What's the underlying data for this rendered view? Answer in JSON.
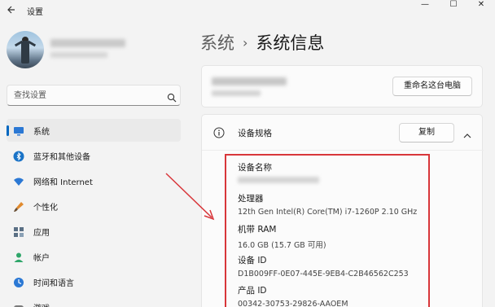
{
  "window": {
    "title": "设置",
    "back_icon": "back-arrow-icon",
    "controls": [
      "—",
      "☐",
      "✕"
    ]
  },
  "search": {
    "placeholder": "查找设置"
  },
  "sidebar": {
    "items": [
      {
        "label": "系统",
        "icon": "monitor-icon",
        "selected": true
      },
      {
        "label": "蓝牙和其他设备",
        "icon": "bluetooth-icon"
      },
      {
        "label": "网络和 Internet",
        "icon": "wifi-icon"
      },
      {
        "label": "个性化",
        "icon": "brush-icon"
      },
      {
        "label": "应用",
        "icon": "apps-icon"
      },
      {
        "label": "帐户",
        "icon": "person-icon"
      },
      {
        "label": "时间和语言",
        "icon": "clock-globe-icon"
      },
      {
        "label": "游戏",
        "icon": "gamepad-icon"
      }
    ]
  },
  "breadcrumb": {
    "parent": "系统",
    "separator": "›",
    "current": "系统信息"
  },
  "device_card": {
    "rename_label": "重命名这台电脑"
  },
  "specs": {
    "title": "设备规格",
    "copy_label": "复制",
    "rows": [
      {
        "label": "设备名称",
        "value": ""
      },
      {
        "label": "处理器",
        "value": "12th Gen Intel(R) Core(TM) i7-1260P   2.10 GHz"
      },
      {
        "label": "机带 RAM",
        "value": "16.0 GB (15.7 GB 可用)"
      },
      {
        "label": "设备 ID",
        "value": "D1B009FF-0E07-445E-9EB4-C2B46562C253"
      },
      {
        "label": "产品 ID",
        "value": "00342-30753-29826-AAOEM"
      }
    ]
  },
  "colors": {
    "accent": "#0067c0",
    "highlight": "#d8363a"
  }
}
